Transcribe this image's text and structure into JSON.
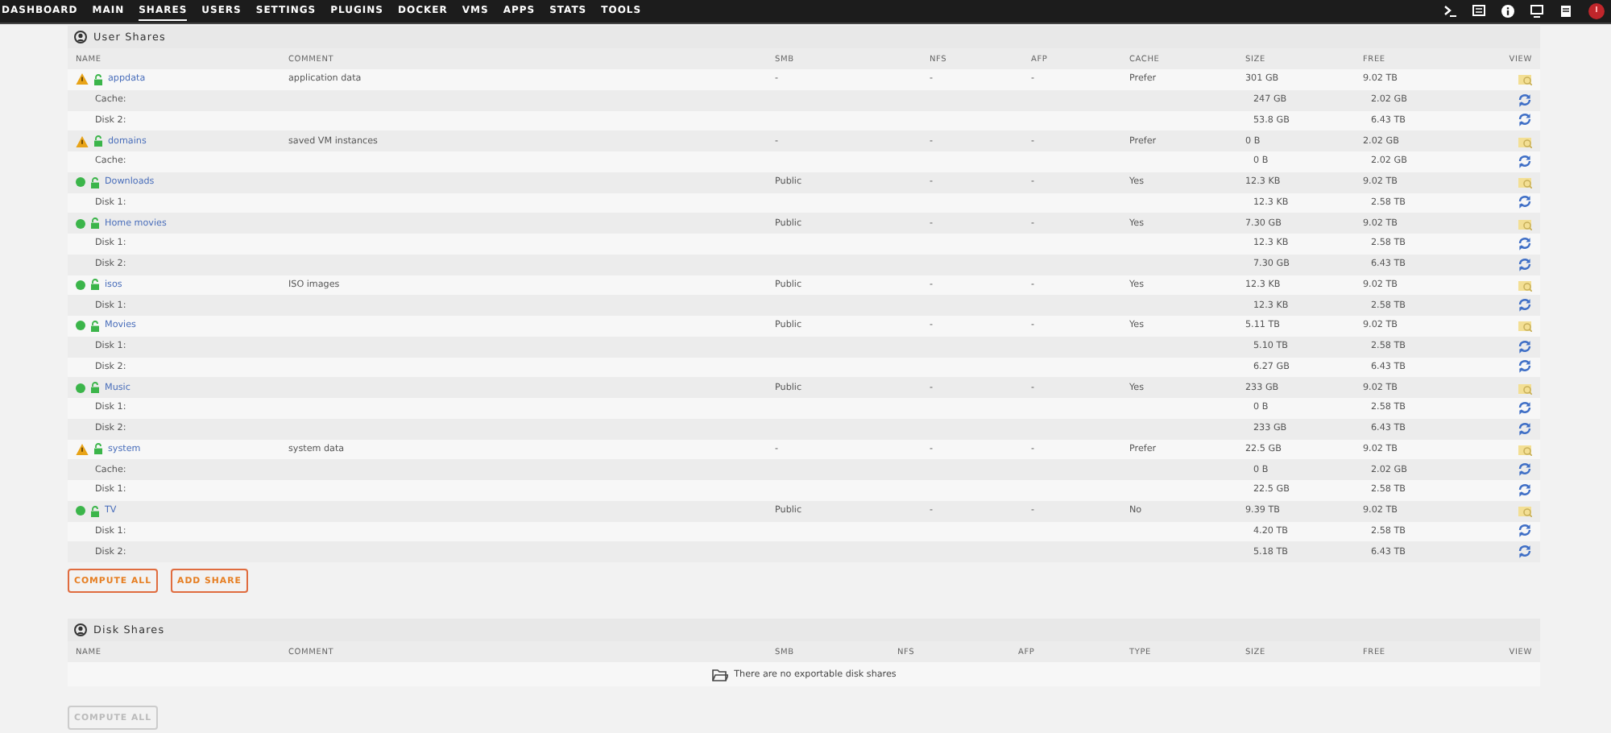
{
  "nav": [
    {
      "label": "DASHBOARD",
      "selected": false
    },
    {
      "label": "MAIN",
      "selected": false
    },
    {
      "label": "SHARES",
      "selected": true
    },
    {
      "label": "USERS",
      "selected": false
    },
    {
      "label": "SETTINGS",
      "selected": false
    },
    {
      "label": "PLUGINS",
      "selected": false
    },
    {
      "label": "DOCKER",
      "selected": false
    },
    {
      "label": "VMS",
      "selected": false
    },
    {
      "label": "APPS",
      "selected": false
    },
    {
      "label": "STATS",
      "selected": false
    },
    {
      "label": "TOOLS",
      "selected": false
    }
  ],
  "user_shares": {
    "title": "User Shares",
    "columns": [
      "NAME",
      "COMMENT",
      "SMB",
      "NFS",
      "AFP",
      "CACHE",
      "SIZE",
      "FREE",
      "VIEW"
    ],
    "rows": [
      {
        "name": "appdata",
        "warning": true,
        "comment": "application data",
        "smb": "-",
        "nfs": "-",
        "afp": "-",
        "cache": "Prefer",
        "size": "301 GB",
        "free": "9.02 TB",
        "disks": [
          {
            "label": "Cache:",
            "size": "247 GB",
            "free": "2.02 GB"
          },
          {
            "label": "Disk 2:",
            "size": "53.8 GB",
            "free": "6.43 TB"
          }
        ]
      },
      {
        "name": "domains",
        "warning": true,
        "comment": "saved VM instances",
        "smb": "-",
        "nfs": "-",
        "afp": "-",
        "cache": "Prefer",
        "size": "0 B",
        "free": "2.02 GB",
        "disks": [
          {
            "label": "Cache:",
            "size": "0 B",
            "free": "2.02 GB"
          }
        ]
      },
      {
        "name": "Downloads",
        "warning": false,
        "smb": "Public",
        "nfs": "-",
        "afp": "-",
        "cache": "Yes",
        "size": "12.3 KB",
        "free": "9.02 TB",
        "disks": [
          {
            "label": "Disk 1:",
            "size": "12.3 KB",
            "free": "2.58 TB"
          }
        ]
      },
      {
        "name": "Home movies",
        "warning": false,
        "smb": "Public",
        "nfs": "-",
        "afp": "-",
        "cache": "Yes",
        "size": "7.30 GB",
        "free": "9.02 TB",
        "disks": [
          {
            "label": "Disk 1:",
            "size": "12.3 KB",
            "free": "2.58 TB"
          },
          {
            "label": "Disk 2:",
            "size": "7.30 GB",
            "free": "6.43 TB"
          }
        ]
      },
      {
        "name": "isos",
        "warning": false,
        "comment": "ISO images",
        "smb": "Public",
        "nfs": "-",
        "afp": "-",
        "cache": "Yes",
        "size": "12.3 KB",
        "free": "9.02 TB",
        "disks": [
          {
            "label": "Disk 1:",
            "size": "12.3 KB",
            "free": "2.58 TB"
          }
        ]
      },
      {
        "name": "Movies",
        "warning": false,
        "smb": "Public",
        "nfs": "-",
        "afp": "-",
        "cache": "Yes",
        "size": "5.11 TB",
        "free": "9.02 TB",
        "disks": [
          {
            "label": "Disk 1:",
            "size": "5.10 TB",
            "free": "2.58 TB"
          },
          {
            "label": "Disk 2:",
            "size": "6.27 GB",
            "free": "6.43 TB"
          }
        ]
      },
      {
        "name": "Music",
        "warning": false,
        "smb": "Public",
        "nfs": "-",
        "afp": "-",
        "cache": "Yes",
        "size": "233 GB",
        "free": "9.02 TB",
        "disks": [
          {
            "label": "Disk 1:",
            "size": "0 B",
            "free": "2.58 TB"
          },
          {
            "label": "Disk 2:",
            "size": "233 GB",
            "free": "6.43 TB"
          }
        ]
      },
      {
        "name": "system",
        "warning": true,
        "comment": "system data",
        "smb": "-",
        "nfs": "-",
        "afp": "-",
        "cache": "Prefer",
        "size": "22.5 GB",
        "free": "9.02 TB",
        "disks": [
          {
            "label": "Cache:",
            "size": "0 B",
            "free": "2.02 GB"
          },
          {
            "label": "Disk 1:",
            "size": "22.5 GB",
            "free": "2.58 TB"
          }
        ]
      },
      {
        "name": "TV",
        "warning": false,
        "smb": "Public",
        "nfs": "-",
        "afp": "-",
        "cache": "No",
        "size": "9.39 TB",
        "free": "9.02 TB",
        "disks": [
          {
            "label": "Disk 1:",
            "size": "4.20 TB",
            "free": "2.58 TB"
          },
          {
            "label": "Disk 2:",
            "size": "5.18 TB",
            "free": "6.43 TB"
          }
        ]
      }
    ],
    "buttons": [
      {
        "label": "COMPUTE ALL",
        "disabled": false
      },
      {
        "label": "ADD SHARE",
        "disabled": false
      }
    ]
  },
  "disk_shares": {
    "title": "Disk Shares",
    "columns": [
      "NAME",
      "COMMENT",
      "SMB",
      "NFS",
      "AFP",
      "TYPE",
      "SIZE",
      "FREE",
      "VIEW"
    ],
    "empty_message": "There are no exportable disk shares",
    "buttons": [
      {
        "label": "COMPUTE ALL",
        "disabled": true
      }
    ]
  }
}
